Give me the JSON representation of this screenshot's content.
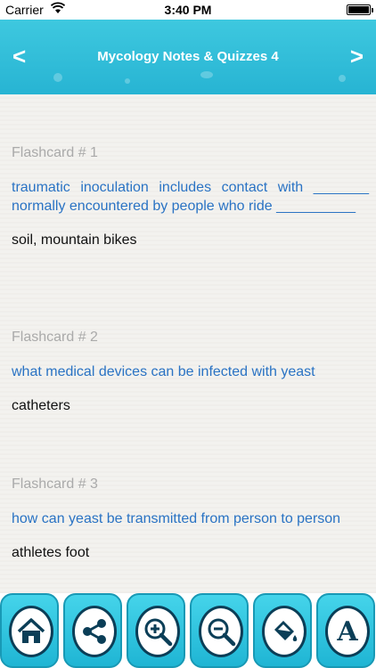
{
  "status_bar": {
    "carrier": "Carrier",
    "time": "3:40 PM"
  },
  "header": {
    "title": "Mycology Notes & Quizzes 4",
    "back_label": "<",
    "forward_label": ">"
  },
  "flashcards": [
    {
      "label": "Flashcard # 1",
      "question": "traumatic inoculation includes contact with _______ normally encountered by people who ride __________",
      "answer": "soil, mountain bikes"
    },
    {
      "label": "Flashcard # 2",
      "question": "what medical devices can be infected with yeast",
      "answer": "catheters"
    },
    {
      "label": "Flashcard # 3",
      "question": "how can yeast be transmitted from person to person",
      "answer": "athletes foot"
    }
  ],
  "toolbar": {
    "buttons": [
      {
        "icon": "home-icon"
      },
      {
        "icon": "share-icon"
      },
      {
        "icon": "zoom-in-icon"
      },
      {
        "icon": "zoom-out-icon"
      },
      {
        "icon": "paint-bucket-icon"
      },
      {
        "icon": "font-icon",
        "glyph": "A"
      }
    ]
  },
  "colors": {
    "accent": "#27b4d3",
    "question": "#2a73c4",
    "label": "#aaaaaa",
    "icon_outline": "#0b3e57"
  }
}
